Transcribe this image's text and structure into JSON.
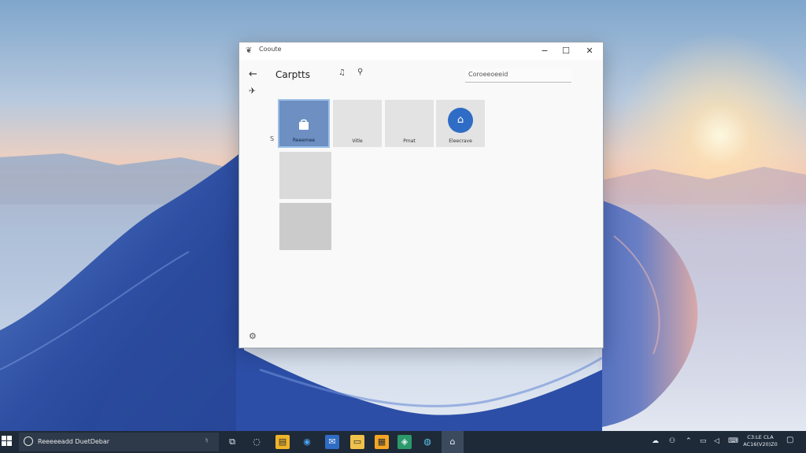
{
  "window": {
    "app_title": "Cooute",
    "page_title": "Carptts",
    "controls": {
      "minimize": "−",
      "maximize": "☐",
      "close": "✕"
    },
    "search": {
      "value": "Coroeeoeeid"
    },
    "icons": {
      "app": "edge-like-icon",
      "back": "back-arrow-icon",
      "pin": "pin-icon",
      "settings": "settings-icon",
      "mic": "mic-icon",
      "search": "search-icon"
    },
    "side_marker": "S"
  },
  "tiles": [
    {
      "label": "Reeemee",
      "icon": "shopping-bag-icon",
      "selected": true,
      "color": "#6e8fc2"
    },
    {
      "label": "Vitle"
    },
    {
      "label": "Pmat"
    },
    {
      "label": "Eleecrave",
      "icon": "display-icon",
      "icon_color": "#2f6cc5"
    },
    {
      "label": ""
    },
    {
      "label": ""
    }
  ],
  "taskbar": {
    "search_text": "Reeeeeadd DuetDebar",
    "clock": {
      "line1": "C3:LE CLA",
      "line2": "AC16(V20)Z0"
    },
    "apps": [
      "task-view-icon",
      "cortana-icon",
      "file-explorer-icon",
      "edge-icon",
      "mail-icon",
      "folder-icon",
      "store-icon",
      "maps-icon",
      "photos-icon",
      "store-active-icon"
    ],
    "tray": [
      "cloud-icon",
      "people-icon",
      "chevron-up-icon",
      "network-icon",
      "volume-icon",
      "keyboard-icon"
    ]
  },
  "colors": {
    "taskbar": "#1f2a38",
    "accent": "#2f6cc5",
    "selected_tile": "#6e8fc2"
  }
}
